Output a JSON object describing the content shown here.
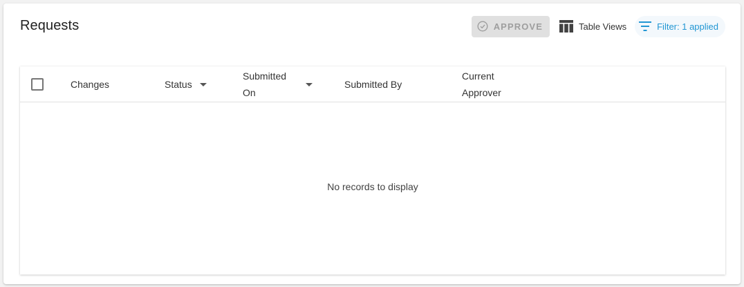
{
  "page": {
    "title": "Requests"
  },
  "toolbar": {
    "approve_label": "APPROVE",
    "table_views_label": "Table Views",
    "filter_label": "Filter: 1 applied"
  },
  "table": {
    "columns": [
      {
        "label": "Changes",
        "sortable": false
      },
      {
        "label": "Status",
        "sortable": true
      },
      {
        "label_line1": "Submitted",
        "label_line2": "On",
        "sortable": true
      },
      {
        "label": "Submitted By",
        "sortable": false
      },
      {
        "label_line1": "Current",
        "label_line2": "Approver",
        "sortable": false
      }
    ],
    "empty_message": "No records to display"
  },
  "colors": {
    "accent": "#2196d3",
    "approve_disabled_bg": "#e0e0e0",
    "approve_disabled_text": "#9e9e9e"
  },
  "icons": {
    "approve": "check-circle-icon",
    "table_views": "table-columns-icon",
    "filter": "filter-list-icon",
    "sort": "sort-down-icon"
  }
}
